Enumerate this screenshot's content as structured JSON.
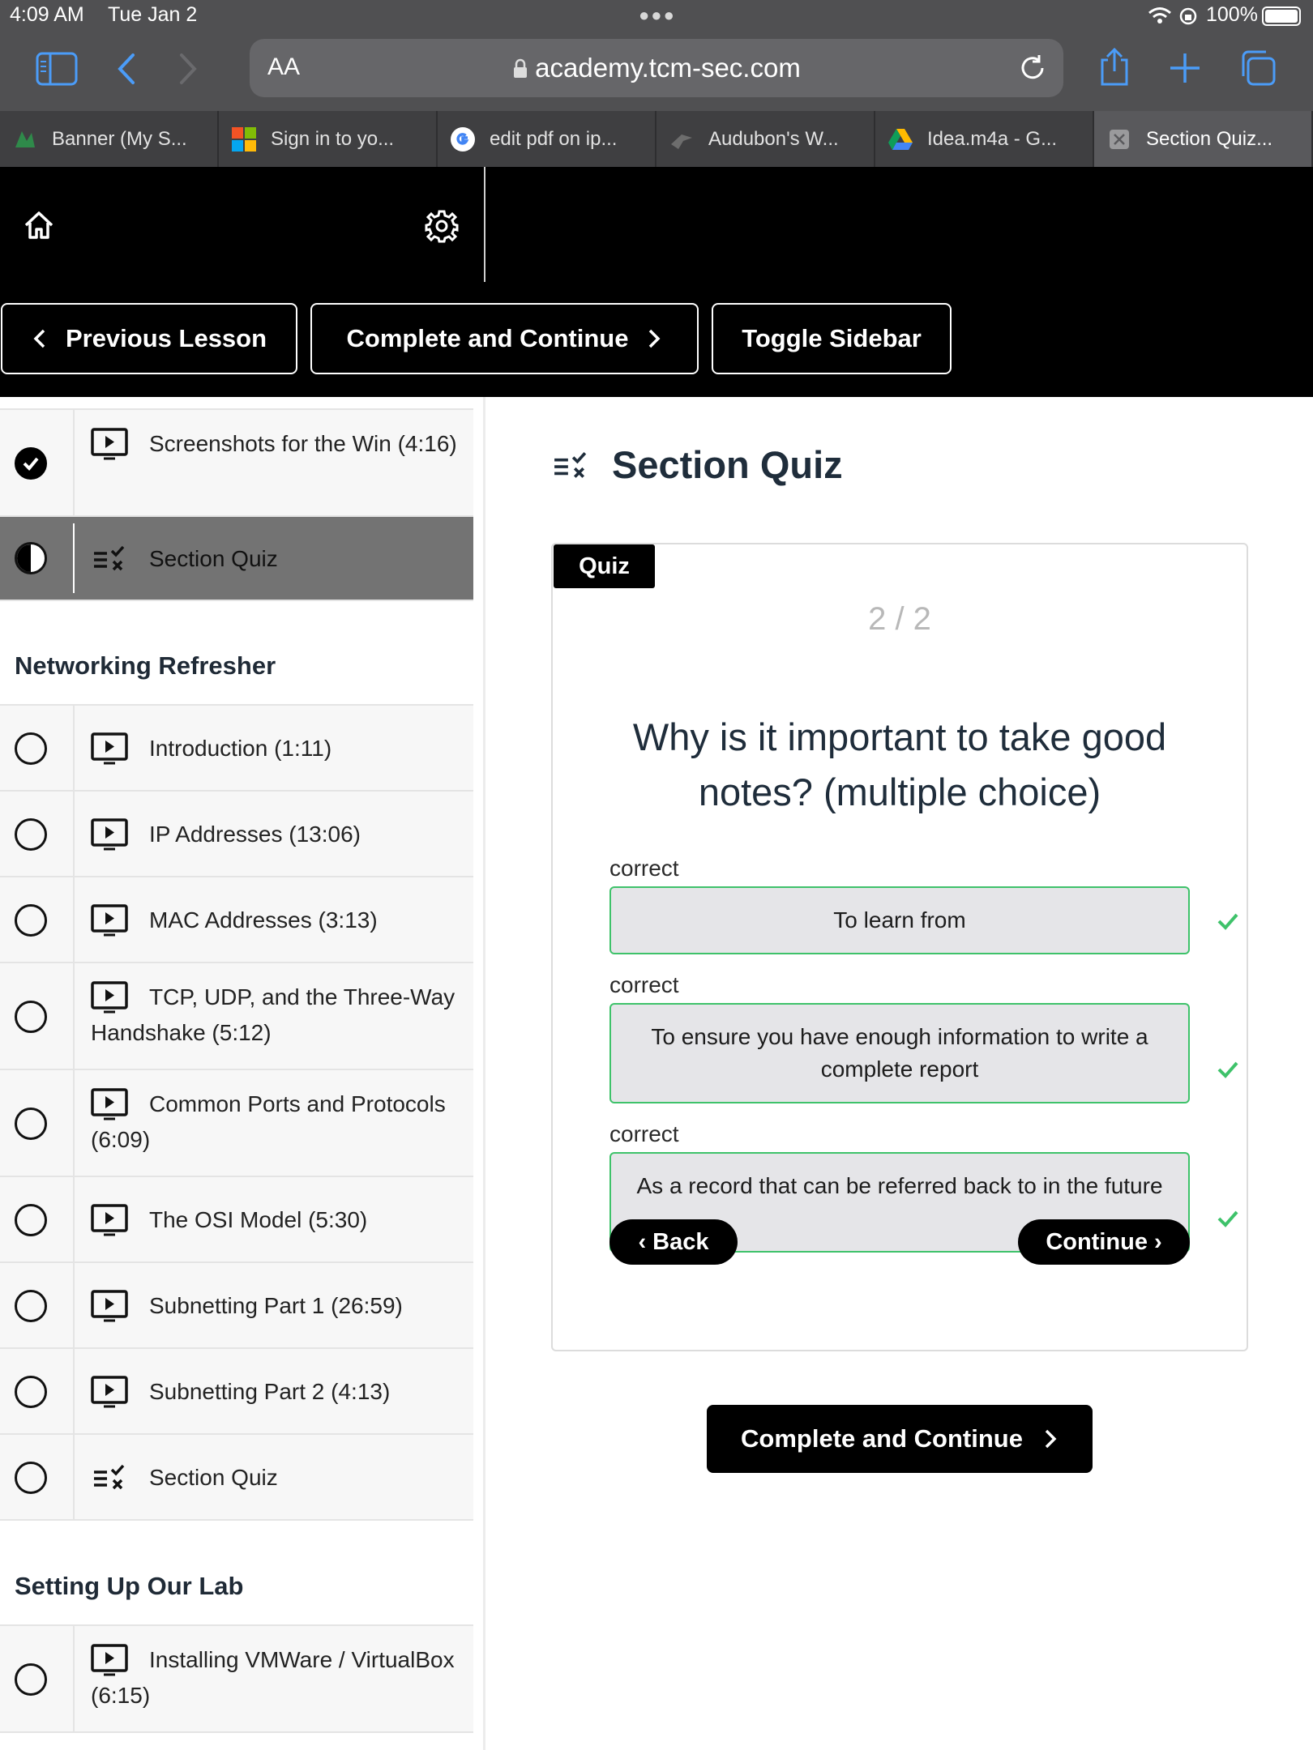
{
  "status_bar": {
    "time": "4:09 AM",
    "date": "Tue Jan 2",
    "battery": "100%"
  },
  "safari": {
    "text_size_button": "AA",
    "url": "academy.tcm-sec.com",
    "tabs": [
      {
        "label": "Banner (My S...",
        "icon": "banner-favicon"
      },
      {
        "label": "Sign in to yo...",
        "icon": "microsoft-favicon"
      },
      {
        "label": "edit pdf on ip...",
        "icon": "google-favicon"
      },
      {
        "label": "Audubon's W...",
        "icon": "audubon-favicon"
      },
      {
        "label": "Idea.m4a - G...",
        "icon": "google-drive-favicon"
      },
      {
        "label": "Section Quiz...",
        "icon": "close-tab-icon",
        "active": true
      }
    ]
  },
  "header": {
    "previous_label": "Previous Lesson",
    "complete_label": "Complete and Continue",
    "toggle_label": "Toggle Sidebar"
  },
  "sidebar": {
    "top_lessons": [
      {
        "title": "Screenshots for the Win (4:16)",
        "type": "video",
        "status": "complete"
      },
      {
        "title": "Section Quiz",
        "type": "quiz",
        "status": "in-progress"
      }
    ],
    "sections": [
      {
        "title": "Networking Refresher",
        "lessons": [
          {
            "title": "Introduction (1:11)",
            "type": "video"
          },
          {
            "title": "IP Addresses (13:06)",
            "type": "video"
          },
          {
            "title": "MAC Addresses (3:13)",
            "type": "video"
          },
          {
            "title": "TCP, UDP, and the Three-Way Handshake (5:12)",
            "type": "video"
          },
          {
            "title": "Common Ports and Protocols (6:09)",
            "type": "video"
          },
          {
            "title": "The OSI Model (5:30)",
            "type": "video"
          },
          {
            "title": "Subnetting Part 1 (26:59)",
            "type": "video"
          },
          {
            "title": "Subnetting Part 2 (4:13)",
            "type": "video"
          },
          {
            "title": "Section Quiz",
            "type": "quiz"
          }
        ]
      },
      {
        "title": "Setting Up Our Lab",
        "lessons": [
          {
            "title": "Installing VMWare / VirtualBox (6:15)",
            "type": "video"
          }
        ]
      }
    ]
  },
  "main": {
    "title": "Section Quiz",
    "quiz": {
      "tag": "Quiz",
      "progress": "2 / 2",
      "question": "Why is it important to take good notes? (multiple choice)",
      "answers": [
        {
          "label": "correct",
          "text": "To learn from"
        },
        {
          "label": "correct",
          "text": "To ensure you have enough information to write a complete report"
        },
        {
          "label": "correct",
          "text": "As a record that can be referred back to in the future"
        }
      ],
      "back_label": "‹ Back",
      "continue_label": "Continue ›"
    },
    "complete_label": "Complete and Continue"
  },
  "colors": {
    "accent_correct": "#3ec26a",
    "safari_blue": "#4b9cf8"
  }
}
